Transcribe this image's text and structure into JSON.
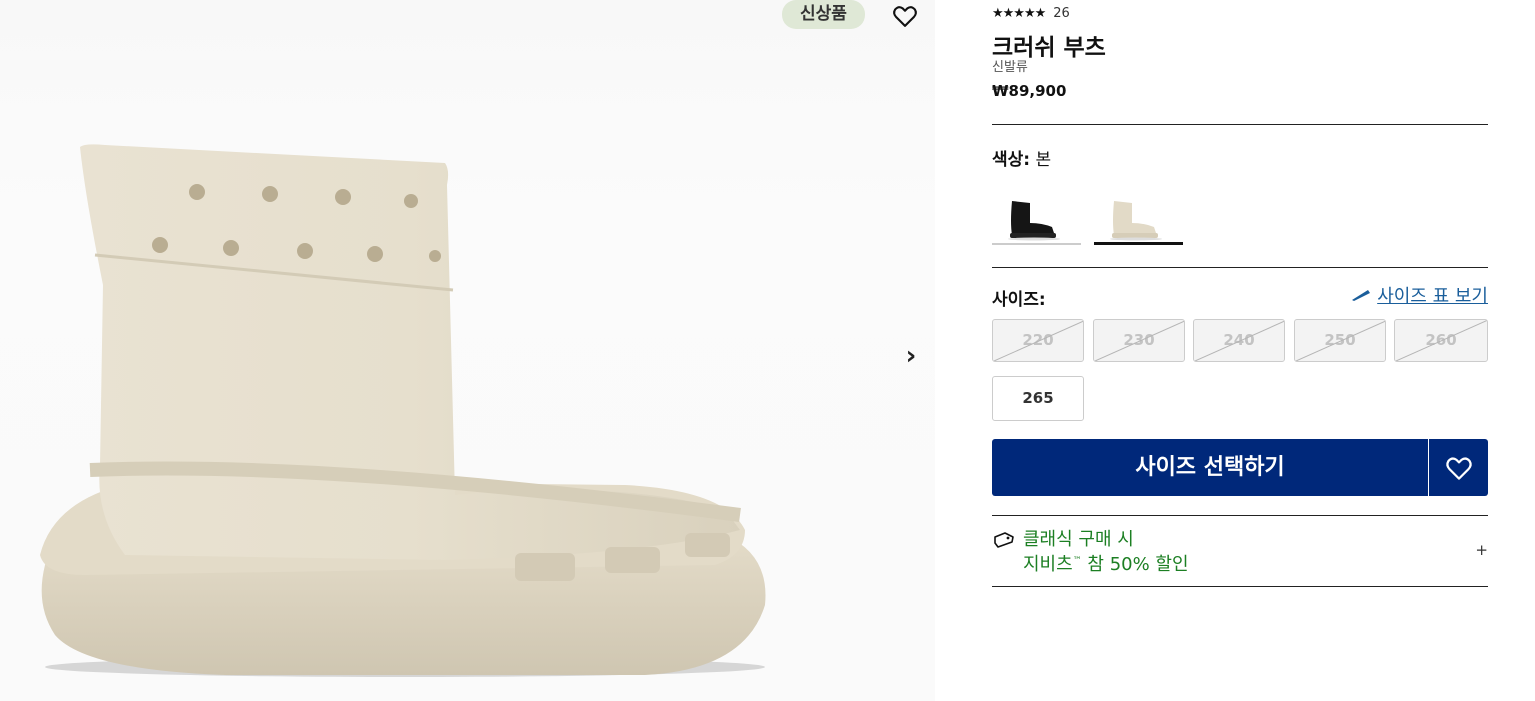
{
  "gallery": {
    "badge": "신상품",
    "wishlist_icon": "heart-outline-icon",
    "next_icon": "chevron-right-icon",
    "next_label": "›"
  },
  "product": {
    "stars": "★★★★★",
    "rating_count": "26",
    "title": "크러쉬 부츠",
    "category": "신발류",
    "price": "₩89,900"
  },
  "color": {
    "label": "색상:",
    "value": "본",
    "swatches": [
      {
        "name": "black",
        "selected": false
      },
      {
        "name": "bone",
        "selected": true
      }
    ]
  },
  "size": {
    "label": "사이즈:",
    "chart_link": "사이즈 표 보기",
    "chart_icon": "ruler-icon",
    "options": [
      {
        "value": "220",
        "available": false
      },
      {
        "value": "230",
        "available": false
      },
      {
        "value": "240",
        "available": false
      },
      {
        "value": "250",
        "available": false
      },
      {
        "value": "260",
        "available": false
      },
      {
        "value": "265",
        "available": true
      }
    ]
  },
  "cta": {
    "label": "사이즈 선택하기",
    "wishlist_icon": "heart-outline-icon"
  },
  "promo": {
    "icon": "tag-icon",
    "line1": "클래식 구매 시",
    "line2_prefix": "지비츠",
    "line2_tm": "™",
    "line2_suffix": " 참 50% 할인",
    "expand": "+"
  },
  "colors": {
    "primary": "#00287a",
    "promo_green": "#1c7f23",
    "link_blue": "#1a5e9b",
    "badge_bg": "#dfe8d6"
  }
}
